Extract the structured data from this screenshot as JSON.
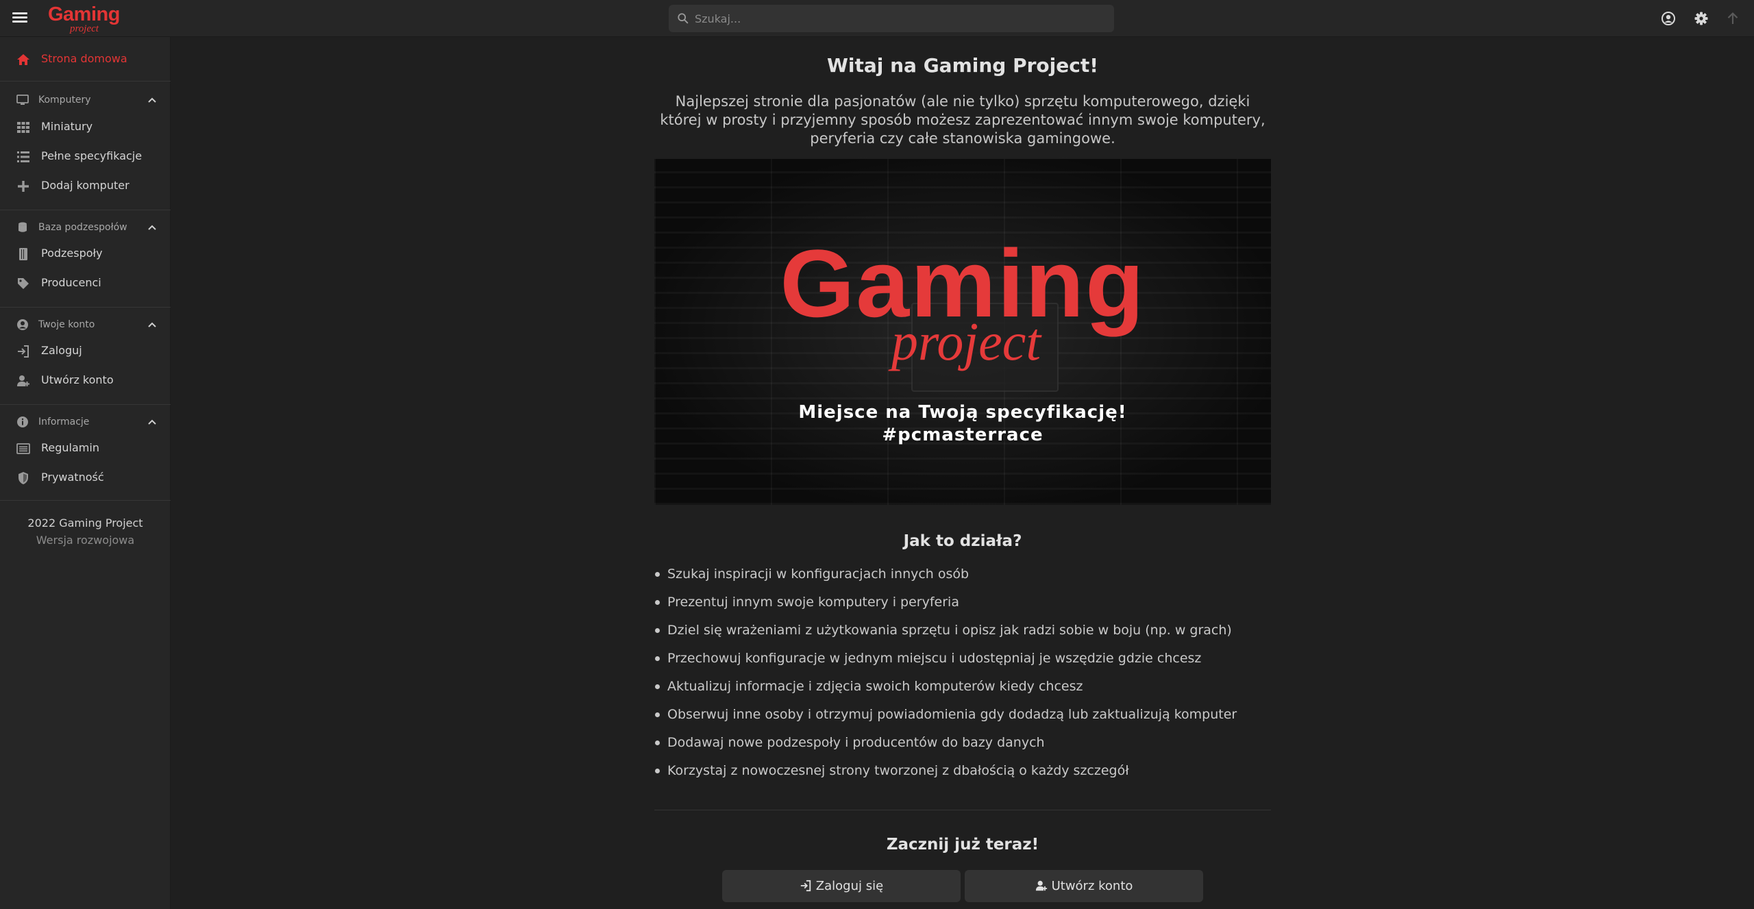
{
  "header": {
    "logo_main": "Gaming",
    "logo_sub": "project",
    "search_placeholder": "Szukaj..."
  },
  "sidebar": {
    "home_label": "Strona domowa",
    "sections": [
      {
        "title": "Komputery",
        "items": [
          "Miniatury",
          "Pełne specyfikacje",
          "Dodaj komputer"
        ]
      },
      {
        "title": "Baza podzespołów",
        "items": [
          "Podzespoły",
          "Producenci"
        ]
      },
      {
        "title": "Twoje konto",
        "items": [
          "Zaloguj",
          "Utwórz konto"
        ]
      },
      {
        "title": "Informacje",
        "items": [
          "Regulamin",
          "Prywatność"
        ]
      }
    ],
    "footer_line1": "2022 Gaming Project",
    "footer_line2": "Wersja rozwojowa"
  },
  "main": {
    "title": "Witaj na Gaming Project!",
    "intro": "Najlepszej stronie dla pasjonatów (ale nie tylko) sprzętu komputerowego, dzięki której w prosty i przyjemny sposób możesz zaprezentować innym swoje komputery, peryferia czy całe stanowiska gamingowe.",
    "banner": {
      "logo_main": "Gaming",
      "logo_sub": "project",
      "line1": "Miejsce na Twoją specyfikację!",
      "line2": "#pcmasterrace"
    },
    "howto_title": "Jak to działa?",
    "features": [
      "Szukaj inspiracji w konfiguracjach innych osób",
      "Prezentuj innym swoje komputery i peryferia",
      "Dziel się wrażeniami z użytkowania sprzętu i opisz jak radzi sobie w boju (np. w grach)",
      "Przechowuj konfiguracje w jednym miejscu i udostępniaj je wszędzie gdzie chcesz",
      "Aktualizuj informacje i zdjęcia swoich komputerów kiedy chcesz",
      "Obserwuj inne osoby i otrzymuj powiadomienia gdy dodadzą lub zaktualizują komputer",
      "Dodawaj nowe podzespoły i producentów do bazy danych",
      "Korzystaj z nowoczesnej strony tworzonej z dbałością o każdy szczegół"
    ],
    "start_title": "Zacznij już teraz!",
    "login_button": "Zaloguj się",
    "register_button": "Utwórz konto"
  },
  "colors": {
    "accent": "#e33535",
    "background": "#1f1f1f",
    "panel": "#262626",
    "button": "#333333"
  }
}
